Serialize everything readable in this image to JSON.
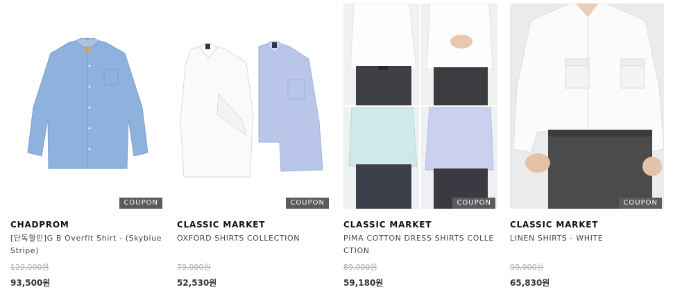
{
  "products": [
    {
      "brand": "CHADPROM",
      "name": "[단독할인]G B Overfit Shirt - (Skyblue Stripe)",
      "original_price": "129,000원",
      "price": "93,500원",
      "coupon": "COUPON",
      "image": "skyblue-shirt-image"
    },
    {
      "brand": "CLASSIC MARKET",
      "name": "OXFORD SHIRTS COLLECTION",
      "original_price": "79,000원",
      "price": "52,530원",
      "coupon": "COUPON",
      "image": "oxford-shirts-image"
    },
    {
      "brand": "CLASSIC MARKET",
      "name": "PIMA COTTON DRESS SHIRTS COLLECTION",
      "original_price": "89,000원",
      "price": "59,180원",
      "coupon": "COUPON",
      "image": "pima-cotton-shirts-image"
    },
    {
      "brand": "CLASSIC MARKET",
      "name": "LINEN SHIRTS - WHITE",
      "original_price": "99,000원",
      "price": "65,830원",
      "coupon": "COUPON",
      "image": "linen-shirt-image"
    }
  ],
  "colors": {
    "coupon_bg": "#5b5b5b",
    "strike_price": "#aaaaaa",
    "skyblue_shirt": "#8eb1dd",
    "lightblue_shirt": "#b9c6ea",
    "mint_shirt": "#cfe9ea",
    "trousers": "#3d3f44"
  }
}
